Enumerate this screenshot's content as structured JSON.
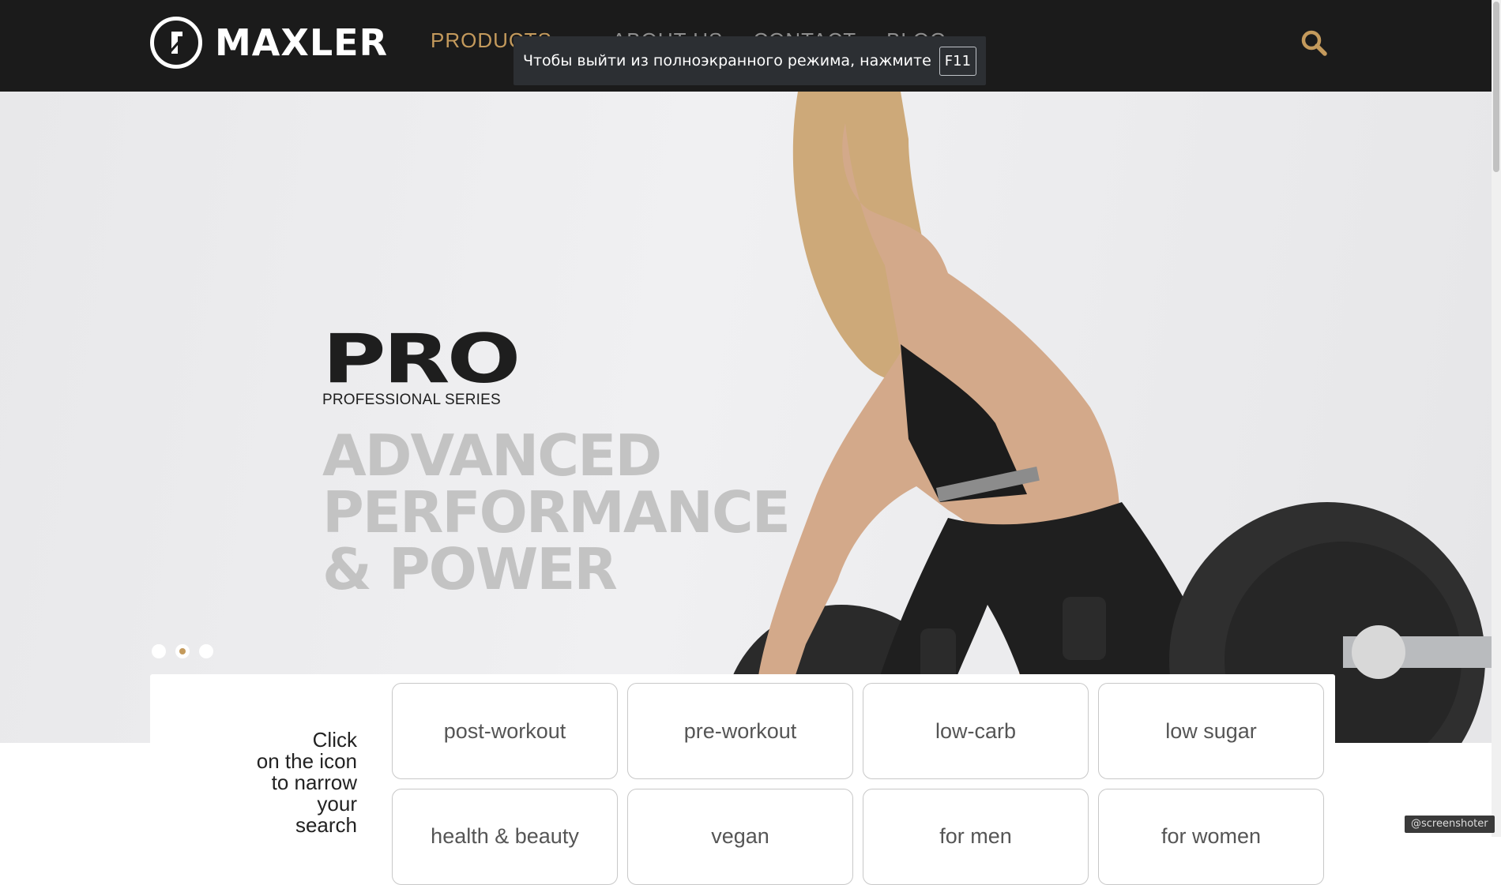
{
  "header": {
    "brand": "MAXLER",
    "nav": [
      {
        "label": "PRODUCTS",
        "active": true,
        "has_dropdown": true
      },
      {
        "label": "ABOUT US",
        "active": false
      },
      {
        "label": "CONTACT",
        "active": false
      },
      {
        "label": "BLOG",
        "active": false
      }
    ],
    "search_icon": "search-icon"
  },
  "fullscreen_notice": {
    "text": "Чтобы выйти из полноэкранного режима, нажмите",
    "key": "F11"
  },
  "hero": {
    "logo_main": "PRO",
    "logo_sub": "PROFESSIONAL SERIES",
    "tagline_lines": [
      "ADVANCED",
      "PERFORMANCE",
      "& POWER"
    ],
    "slide_dots": 3,
    "active_slide": 2
  },
  "filters": {
    "hint_lines": [
      "Click",
      "on the icon",
      "to narrow",
      "your",
      "search"
    ],
    "options": [
      "post-workout",
      "pre-workout",
      "low-carb",
      "low sugar",
      "health & beauty",
      "vegan",
      "for men",
      "for women"
    ]
  },
  "watermark": "@screenshoter",
  "colors": {
    "header_bg": "#1b1b1b",
    "accent": "#c49a5c",
    "nav_inactive": "#8e8e8e"
  }
}
